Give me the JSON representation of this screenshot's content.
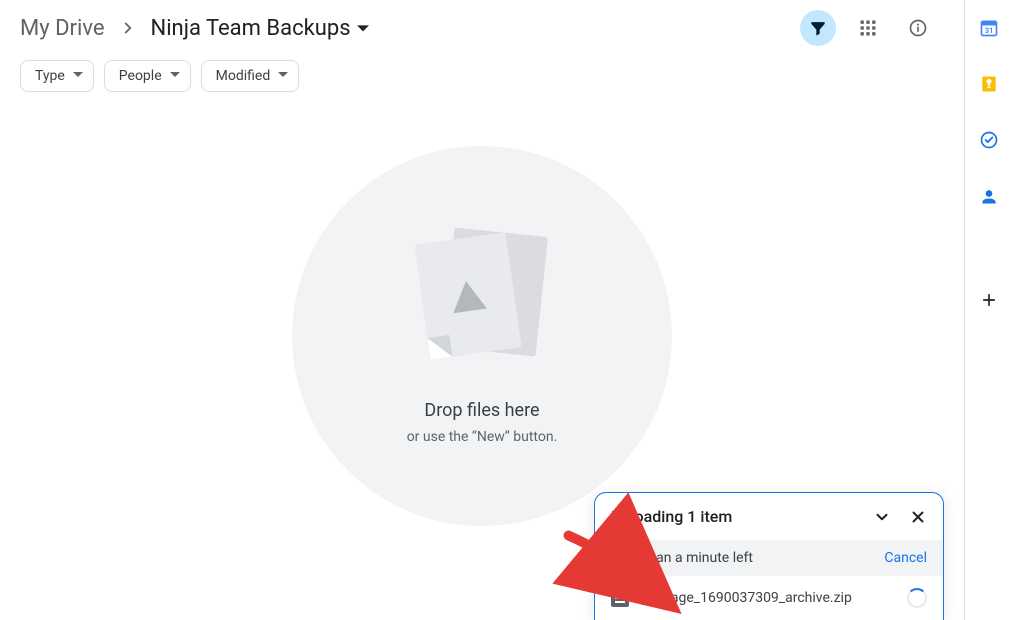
{
  "breadcrumb": {
    "root": "My Drive",
    "current": "Ninja Team Backups"
  },
  "header_icons": {
    "filter_name": "filter-icon",
    "view_name": "grid-view-icon",
    "info_name": "info-icon"
  },
  "filters": {
    "chips": [
      {
        "label": "Type",
        "name": "filter-type"
      },
      {
        "label": "People",
        "name": "filter-people"
      },
      {
        "label": "Modified",
        "name": "filter-modified"
      }
    ]
  },
  "empty": {
    "title": "Drop files here",
    "subtitle": "or use the “New” button."
  },
  "upload": {
    "title": "Uploading 1 item",
    "eta": "Less than a minute left",
    "cancel": "Cancel",
    "file": "package_1690037309_archive.zip"
  },
  "side_apps": {
    "calendar_label": "Calendar",
    "keep_label": "Keep",
    "tasks_label": "Tasks",
    "contacts_label": "Contacts",
    "add_label": "Add-ons"
  }
}
